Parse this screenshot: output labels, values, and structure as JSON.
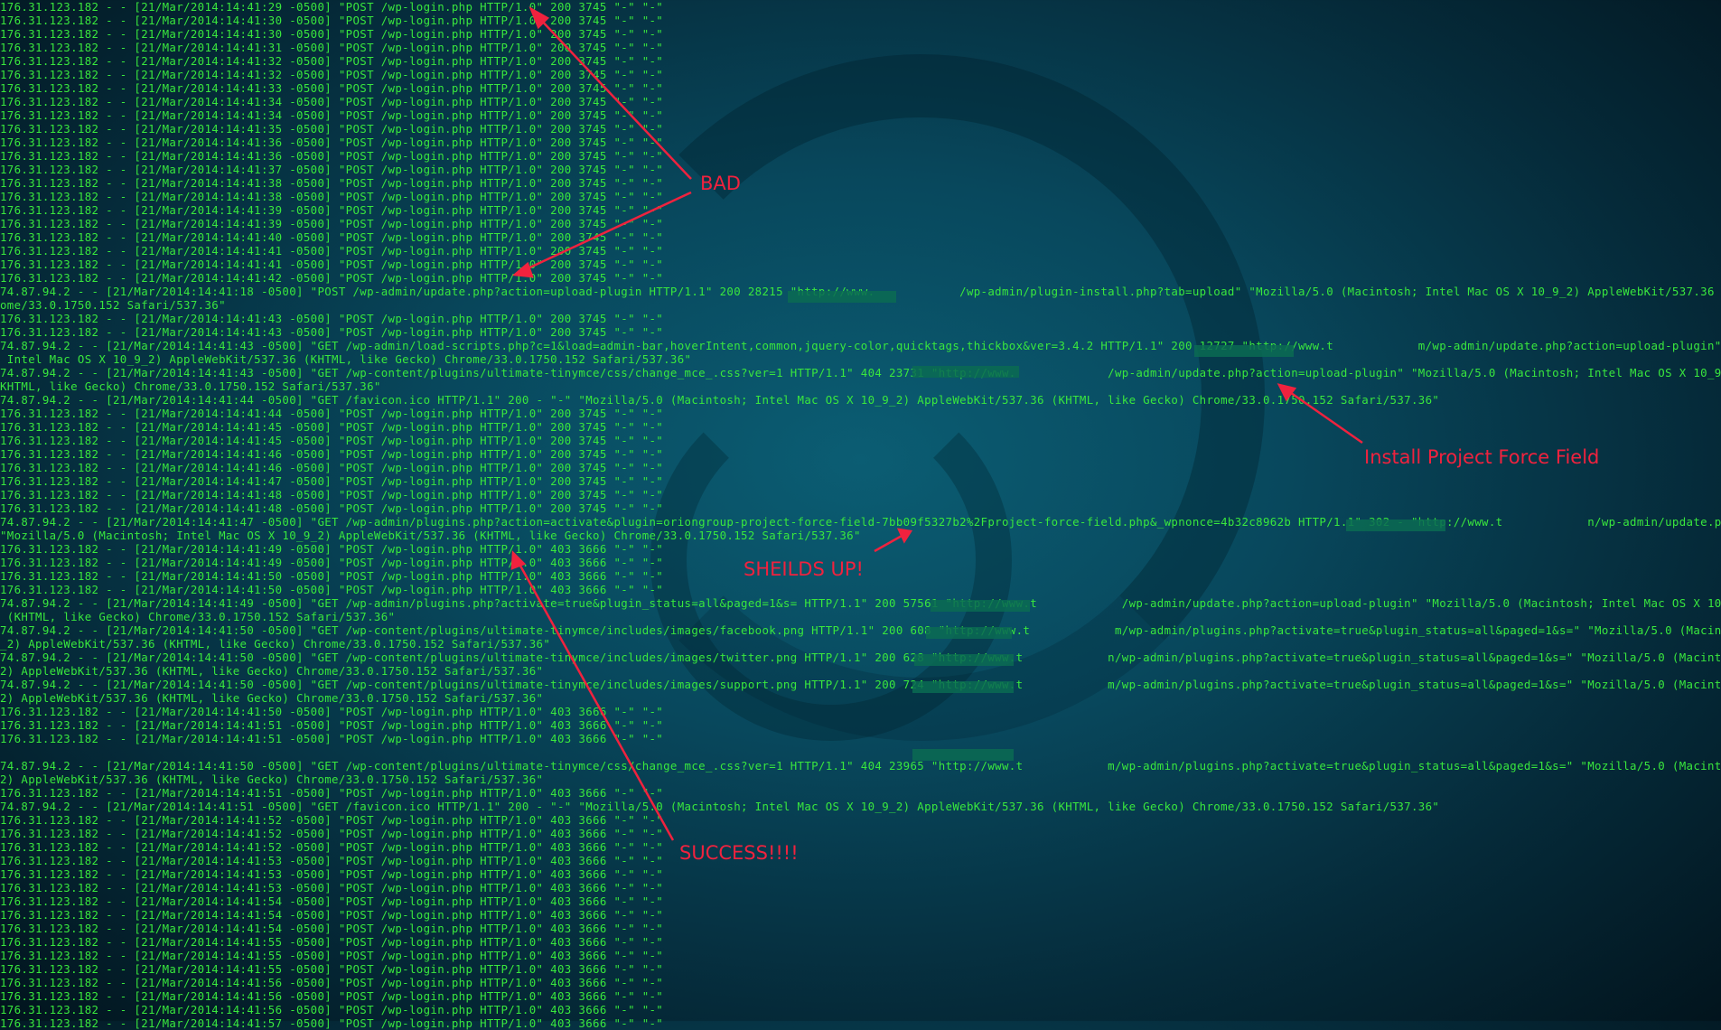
{
  "log_lines": [
    "176.31.123.182 - - [21/Mar/2014:14:41:29 -0500] \"POST /wp-login.php HTTP/1.0\" 200 3745 \"-\" \"-\"",
    "176.31.123.182 - - [21/Mar/2014:14:41:30 -0500] \"POST /wp-login.php HTTP/1.0\" 200 3745 \"-\" \"-\"",
    "176.31.123.182 - - [21/Mar/2014:14:41:30 -0500] \"POST /wp-login.php HTTP/1.0\" 200 3745 \"-\" \"-\"",
    "176.31.123.182 - - [21/Mar/2014:14:41:31 -0500] \"POST /wp-login.php HTTP/1.0\" 200 3745 \"-\" \"-\"",
    "176.31.123.182 - - [21/Mar/2014:14:41:32 -0500] \"POST /wp-login.php HTTP/1.0\" 200 3745 \"-\" \"-\"",
    "176.31.123.182 - - [21/Mar/2014:14:41:32 -0500] \"POST /wp-login.php HTTP/1.0\" 200 3745 \"-\" \"-\"",
    "176.31.123.182 - - [21/Mar/2014:14:41:33 -0500] \"POST /wp-login.php HTTP/1.0\" 200 3745 \"-\" \"-\"",
    "176.31.123.182 - - [21/Mar/2014:14:41:34 -0500] \"POST /wp-login.php HTTP/1.0\" 200 3745 \"-\" \"-\"",
    "176.31.123.182 - - [21/Mar/2014:14:41:34 -0500] \"POST /wp-login.php HTTP/1.0\" 200 3745 \"-\" \"-\"",
    "176.31.123.182 - - [21/Mar/2014:14:41:35 -0500] \"POST /wp-login.php HTTP/1.0\" 200 3745 \"-\" \"-\"",
    "176.31.123.182 - - [21/Mar/2014:14:41:36 -0500] \"POST /wp-login.php HTTP/1.0\" 200 3745 \"-\" \"-\"",
    "176.31.123.182 - - [21/Mar/2014:14:41:36 -0500] \"POST /wp-login.php HTTP/1.0\" 200 3745 \"-\" \"-\"",
    "176.31.123.182 - - [21/Mar/2014:14:41:37 -0500] \"POST /wp-login.php HTTP/1.0\" 200 3745 \"-\" \"-\"",
    "176.31.123.182 - - [21/Mar/2014:14:41:38 -0500] \"POST /wp-login.php HTTP/1.0\" 200 3745 \"-\" \"-\"",
    "176.31.123.182 - - [21/Mar/2014:14:41:38 -0500] \"POST /wp-login.php HTTP/1.0\" 200 3745 \"-\" \"-\"",
    "176.31.123.182 - - [21/Mar/2014:14:41:39 -0500] \"POST /wp-login.php HTTP/1.0\" 200 3745 \"-\" \"-\"",
    "176.31.123.182 - - [21/Mar/2014:14:41:39 -0500] \"POST /wp-login.php HTTP/1.0\" 200 3745 \"-\" \"-\"",
    "176.31.123.182 - - [21/Mar/2014:14:41:40 -0500] \"POST /wp-login.php HTTP/1.0\" 200 3745 \"-\" \"-\"",
    "176.31.123.182 - - [21/Mar/2014:14:41:41 -0500] \"POST /wp-login.php HTTP/1.0\" 200 3745 \"-\" \"-\"",
    "176.31.123.182 - - [21/Mar/2014:14:41:41 -0500] \"POST /wp-login.php HTTP/1.0\" 200 3745 \"-\" \"-\"",
    "176.31.123.182 - - [21/Mar/2014:14:41:42 -0500] \"POST /wp-login.php HTTP/1.0\" 200 3745 \"-\" \"-\"",
    "74.87.94.2 - - [21/Mar/2014:14:41:18 -0500] \"POST /wp-admin/update.php?action=upload-plugin HTTP/1.1\" 200 28215 \"http://www.            /wp-admin/plugin-install.php?tab=upload\" \"Mozilla/5.0 (Macintosh; Intel Mac OS X 10_9_2) AppleWebKit/537.36 (KHTML, like Gecko) Chr",
    "ome/33.0.1750.152 Safari/537.36\"",
    "176.31.123.182 - - [21/Mar/2014:14:41:43 -0500] \"POST /wp-login.php HTTP/1.0\" 200 3745 \"-\" \"-\"",
    "176.31.123.182 - - [21/Mar/2014:14:41:43 -0500] \"POST /wp-login.php HTTP/1.0\" 200 3745 \"-\" \"-\"",
    "74.87.94.2 - - [21/Mar/2014:14:41:43 -0500] \"GET /wp-admin/load-scripts.php?c=1&load=admin-bar,hoverIntent,common,jquery-color,quicktags,thickbox&ver=3.4.2 HTTP/1.1\" 200 12727 \"http://www.t            m/wp-admin/update.php?action=upload-plugin\" \"Mozilla/5.0 (Macintosh;",
    " Intel Mac OS X 10_9_2) AppleWebKit/537.36 (KHTML, like Gecko) Chrome/33.0.1750.152 Safari/537.36\"",
    "74.87.94.2 - - [21/Mar/2014:14:41:43 -0500] \"GET /wp-content/plugins/ultimate-tinymce/css/change_mce_.css?ver=1 HTTP/1.1\" 404 23731 \"http://www.             /wp-admin/update.php?action=upload-plugin\" \"Mozilla/5.0 (Macintosh; Intel Mac OS X 10_9_2) AppleWebKit/537.36 (",
    "KHTML, like Gecko) Chrome/33.0.1750.152 Safari/537.36\"",
    "74.87.94.2 - - [21/Mar/2014:14:41:44 -0500] \"GET /favicon.ico HTTP/1.1\" 200 - \"-\" \"Mozilla/5.0 (Macintosh; Intel Mac OS X 10_9_2) AppleWebKit/537.36 (KHTML, like Gecko) Chrome/33.0.1750.152 Safari/537.36\"",
    "176.31.123.182 - - [21/Mar/2014:14:41:44 -0500] \"POST /wp-login.php HTTP/1.0\" 200 3745 \"-\" \"-\"",
    "176.31.123.182 - - [21/Mar/2014:14:41:45 -0500] \"POST /wp-login.php HTTP/1.0\" 200 3745 \"-\" \"-\"",
    "176.31.123.182 - - [21/Mar/2014:14:41:45 -0500] \"POST /wp-login.php HTTP/1.0\" 200 3745 \"-\" \"-\"",
    "176.31.123.182 - - [21/Mar/2014:14:41:46 -0500] \"POST /wp-login.php HTTP/1.0\" 200 3745 \"-\" \"-\"",
    "176.31.123.182 - - [21/Mar/2014:14:41:46 -0500] \"POST /wp-login.php HTTP/1.0\" 200 3745 \"-\" \"-\"",
    "176.31.123.182 - - [21/Mar/2014:14:41:47 -0500] \"POST /wp-login.php HTTP/1.0\" 200 3745 \"-\" \"-\"",
    "176.31.123.182 - - [21/Mar/2014:14:41:48 -0500] \"POST /wp-login.php HTTP/1.0\" 200 3745 \"-\" \"-\"",
    "176.31.123.182 - - [21/Mar/2014:14:41:48 -0500] \"POST /wp-login.php HTTP/1.0\" 200 3745 \"-\" \"-\"",
    "74.87.94.2 - - [21/Mar/2014:14:41:47 -0500] \"GET /wp-admin/plugins.php?action=activate&plugin=oriongroup-project-force-field-7bb09f5327b2%2Fproject-force-field.php&_wpnonce=4b32c8962b HTTP/1.1\" 302 - \"http://www.t            n/wp-admin/update.php?action=upload-plugin\"",
    "\"Mozilla/5.0 (Macintosh; Intel Mac OS X 10_9_2) AppleWebKit/537.36 (KHTML, like Gecko) Chrome/33.0.1750.152 Safari/537.36\"",
    "176.31.123.182 - - [21/Mar/2014:14:41:49 -0500] \"POST /wp-login.php HTTP/1.0\" 403 3666 \"-\" \"-\"",
    "176.31.123.182 - - [21/Mar/2014:14:41:49 -0500] \"POST /wp-login.php HTTP/1.0\" 403 3666 \"-\" \"-\"",
    "176.31.123.182 - - [21/Mar/2014:14:41:50 -0500] \"POST /wp-login.php HTTP/1.0\" 403 3666 \"-\" \"-\"",
    "176.31.123.182 - - [21/Mar/2014:14:41:50 -0500] \"POST /wp-login.php HTTP/1.0\" 403 3666 \"-\" \"-\"",
    "74.87.94.2 - - [21/Mar/2014:14:41:49 -0500] \"GET /wp-admin/plugins.php?activate=true&plugin_status=all&paged=1&s= HTTP/1.1\" 200 57561 \"http://www.t            /wp-admin/update.php?action=upload-plugin\" \"Mozilla/5.0 (Macintosh; Intel Mac OS X 10_9_2) AppleWebKit/537.36",
    " (KHTML, like Gecko) Chrome/33.0.1750.152 Safari/537.36\"",
    "74.87.94.2 - - [21/Mar/2014:14:41:50 -0500] \"GET /wp-content/plugins/ultimate-tinymce/includes/images/facebook.png HTTP/1.1\" 200 608 \"http://www.t            m/wp-admin/plugins.php?activate=true&plugin_status=all&paged=1&s=\" \"Mozilla/5.0 (Macintosh; Intel Mac OS X 10_9",
    "_2) AppleWebKit/537.36 (KHTML, like Gecko) Chrome/33.0.1750.152 Safari/537.36\"",
    "74.87.94.2 - - [21/Mar/2014:14:41:50 -0500] \"GET /wp-content/plugins/ultimate-tinymce/includes/images/twitter.png HTTP/1.1\" 200 628 \"http://www.t            n/wp-admin/plugins.php?activate=true&plugin_status=all&paged=1&s=\" \"Mozilla/5.0 (Macintosh; Intel Mac OS X 10_9_",
    "2) AppleWebKit/537.36 (KHTML, like Gecko) Chrome/33.0.1750.152 Safari/537.36\"",
    "74.87.94.2 - - [21/Mar/2014:14:41:50 -0500] \"GET /wp-content/plugins/ultimate-tinymce/includes/images/support.png HTTP/1.1\" 200 724 \"http://www.t            m/wp-admin/plugins.php?activate=true&plugin_status=all&paged=1&s=\" \"Mozilla/5.0 (Macintosh; Intel Mac OS X 10_9_",
    "2) AppleWebKit/537.36 (KHTML, like Gecko) Chrome/33.0.1750.152 Safari/537.36\"",
    "176.31.123.182 - - [21/Mar/2014:14:41:50 -0500] \"POST /wp-login.php HTTP/1.0\" 403 3666 \"-\" \"-\"",
    "176.31.123.182 - - [21/Mar/2014:14:41:51 -0500] \"POST /wp-login.php HTTP/1.0\" 403 3666 \"-\" \"-\"",
    "176.31.123.182 - - [21/Mar/2014:14:41:51 -0500] \"POST /wp-login.php HTTP/1.0\" 403 3666 \"-\" \"-\"",
    "",
    "74.87.94.2 - - [21/Mar/2014:14:41:50 -0500] \"GET /wp-content/plugins/ultimate-tinymce/css/change_mce_.css?ver=1 HTTP/1.1\" 404 23965 \"http://www.t            m/wp-admin/plugins.php?activate=true&plugin_status=all&paged=1&s=\" \"Mozilla/5.0 (Macintosh; Intel Mac OS X 10_9_",
    "2) AppleWebKit/537.36 (KHTML, like Gecko) Chrome/33.0.1750.152 Safari/537.36\"",
    "176.31.123.182 - - [21/Mar/2014:14:41:51 -0500] \"POST /wp-login.php HTTP/1.0\" 403 3666 \"-\" \"-\"",
    "74.87.94.2 - - [21/Mar/2014:14:41:51 -0500] \"GET /favicon.ico HTTP/1.1\" 200 - \"-\" \"Mozilla/5.0 (Macintosh; Intel Mac OS X 10_9_2) AppleWebKit/537.36 (KHTML, like Gecko) Chrome/33.0.1750.152 Safari/537.36\"",
    "176.31.123.182 - - [21/Mar/2014:14:41:52 -0500] \"POST /wp-login.php HTTP/1.0\" 403 3666 \"-\" \"-\"",
    "176.31.123.182 - - [21/Mar/2014:14:41:52 -0500] \"POST /wp-login.php HTTP/1.0\" 403 3666 \"-\" \"-\"",
    "176.31.123.182 - - [21/Mar/2014:14:41:52 -0500] \"POST /wp-login.php HTTP/1.0\" 403 3666 \"-\" \"-\"",
    "176.31.123.182 - - [21/Mar/2014:14:41:53 -0500] \"POST /wp-login.php HTTP/1.0\" 403 3666 \"-\" \"-\"",
    "176.31.123.182 - - [21/Mar/2014:14:41:53 -0500] \"POST /wp-login.php HTTP/1.0\" 403 3666 \"-\" \"-\"",
    "176.31.123.182 - - [21/Mar/2014:14:41:53 -0500] \"POST /wp-login.php HTTP/1.0\" 403 3666 \"-\" \"-\"",
    "176.31.123.182 - - [21/Mar/2014:14:41:54 -0500] \"POST /wp-login.php HTTP/1.0\" 403 3666 \"-\" \"-\"",
    "176.31.123.182 - - [21/Mar/2014:14:41:54 -0500] \"POST /wp-login.php HTTP/1.0\" 403 3666 \"-\" \"-\"",
    "176.31.123.182 - - [21/Mar/2014:14:41:54 -0500] \"POST /wp-login.php HTTP/1.0\" 403 3666 \"-\" \"-\"",
    "176.31.123.182 - - [21/Mar/2014:14:41:55 -0500] \"POST /wp-login.php HTTP/1.0\" 403 3666 \"-\" \"-\"",
    "176.31.123.182 - - [21/Mar/2014:14:41:55 -0500] \"POST /wp-login.php HTTP/1.0\" 403 3666 \"-\" \"-\"",
    "176.31.123.182 - - [21/Mar/2014:14:41:55 -0500] \"POST /wp-login.php HTTP/1.0\" 403 3666 \"-\" \"-\"",
    "176.31.123.182 - - [21/Mar/2014:14:41:56 -0500] \"POST /wp-login.php HTTP/1.0\" 403 3666 \"-\" \"-\"",
    "176.31.123.182 - - [21/Mar/2014:14:41:56 -0500] \"POST /wp-login.php HTTP/1.0\" 403 3666 \"-\" \"-\"",
    "176.31.123.182 - - [21/Mar/2014:14:41:56 -0500] \"POST /wp-login.php HTTP/1.0\" 403 3666 \"-\" \"-\"",
    "176.31.123.182 - - [21/Mar/2014:14:41:57 -0500] \"POST /wp-login.php HTTP/1.0\" 403 3666 \"-\" \"-\""
  ],
  "annotations": {
    "bad": "BAD",
    "install": "Install Project Force Field",
    "shields": "SHEILDS UP!",
    "success": "SUCCESS!!!!"
  },
  "colors": {
    "log_text": "#39e73d",
    "annotation": "#f0223e",
    "background": "#08485d"
  }
}
